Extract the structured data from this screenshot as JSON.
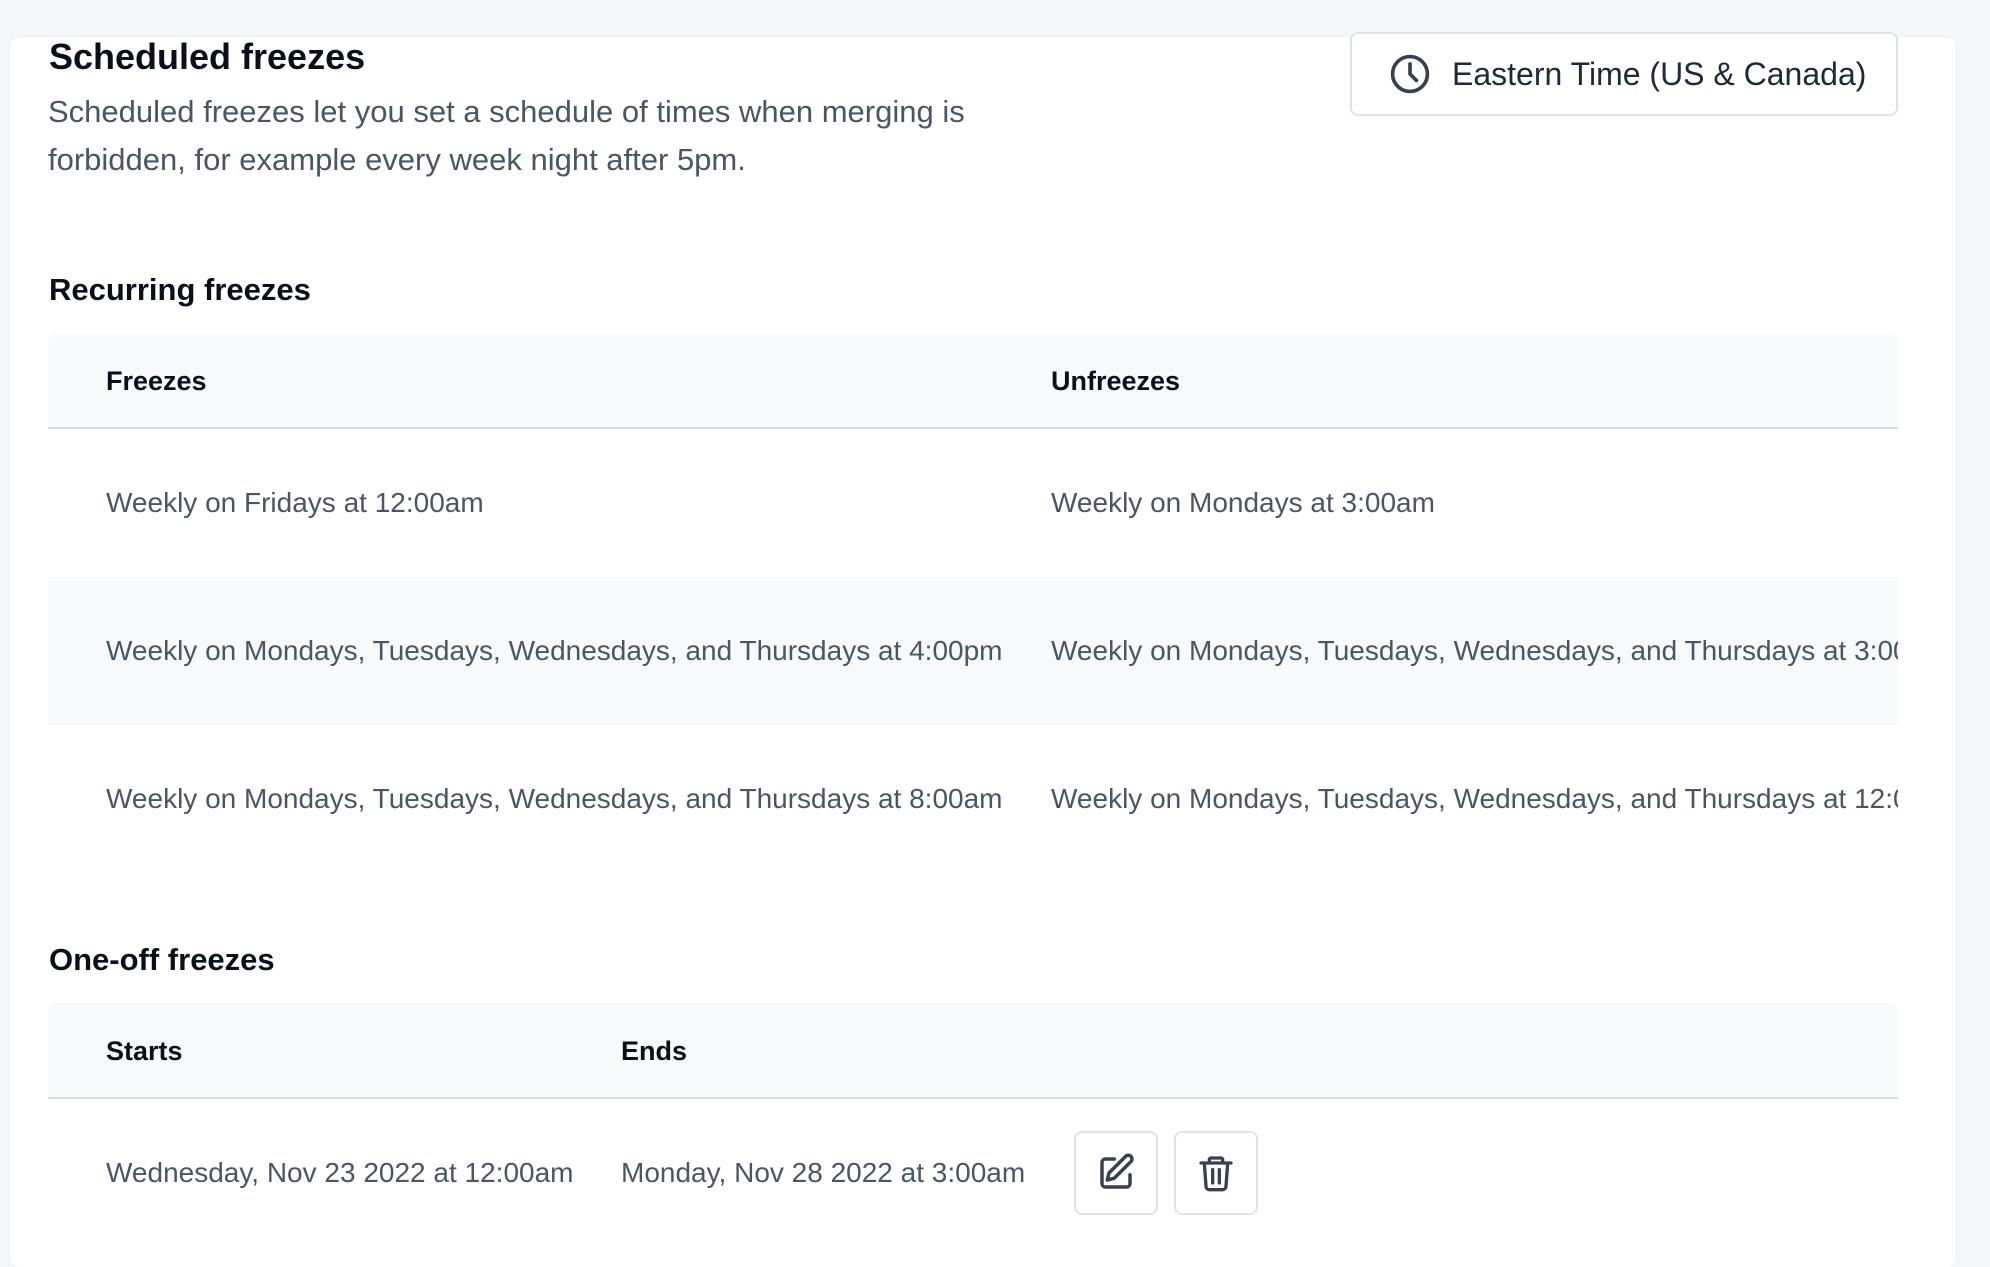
{
  "header": {
    "title": "Scheduled freezes",
    "description": "Scheduled freezes let you set a schedule of times when merging is forbidden, for example every week night after 5pm.",
    "timezone_label": "Eastern Time (US & Canada)",
    "timezone_icon": "clock-icon"
  },
  "recurring": {
    "title": "Recurring freezes",
    "columns": [
      "Freezes",
      "Unfreezes"
    ],
    "rows": [
      {
        "freezes": "Weekly on Fridays at 12:00am",
        "unfreezes": "Weekly on Mondays at 3:00am"
      },
      {
        "freezes": "Weekly on Mondays, Tuesdays, Wednesdays, and Thursdays at 4:00pm",
        "unfreezes": "Weekly on Mondays, Tuesdays, Wednesdays, and Thursdays at 3:00"
      },
      {
        "freezes": "Weekly on Mondays, Tuesdays, Wednesdays, and Thursdays at 8:00am",
        "unfreezes": "Weekly on Mondays, Tuesdays, Wednesdays, and Thursdays at 12:0"
      }
    ]
  },
  "oneoff": {
    "title": "One-off freezes",
    "columns": [
      "Starts",
      "Ends"
    ],
    "rows": [
      {
        "starts": "Wednesday, Nov 23 2022 at 12:00am",
        "ends": "Monday, Nov 28 2022 at 3:00am",
        "edit_icon": "edit-icon",
        "delete_icon": "trash-icon"
      }
    ]
  }
}
